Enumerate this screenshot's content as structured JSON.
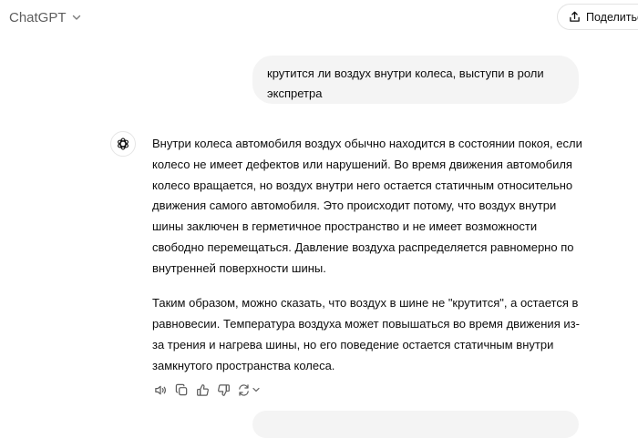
{
  "header": {
    "model_name": "ChatGPT",
    "share_label": "Поделиться"
  },
  "conversation": {
    "user_message": "крутится ли воздух внутри колеса, выступи в роли экспретра",
    "assistant_paragraphs": [
      "Внутри колеса автомобиля воздух обычно находится в состоянии покоя, если колесо не имеет дефектов или нарушений. Во время движения автомобиля колесо вращается, но воздух внутри него остается статичным относительно движения самого автомобиля. Это происходит потому, что воздух внутри шины заключен в герметичное пространство и не имеет возможности свободно перемещаться. Давление воздуха распределяется равномерно по внутренней поверхности шины.",
      "Таким образом, можно сказать, что воздух в шине не \"крутится\", а остается в равновесии. Температура воздуха может повышаться во время движения из-за трения и нагрева шины, но его поведение остается статичным внутри замкнутого пространства колеса."
    ]
  },
  "actions": [
    "speaker-icon",
    "copy-icon",
    "thumbs-up-icon",
    "thumbs-down-icon",
    "regenerate-icon"
  ],
  "colors": {
    "user_bubble": "#f4f4f4",
    "text": "#0d0d0d",
    "muted": "#5d5d5d"
  }
}
